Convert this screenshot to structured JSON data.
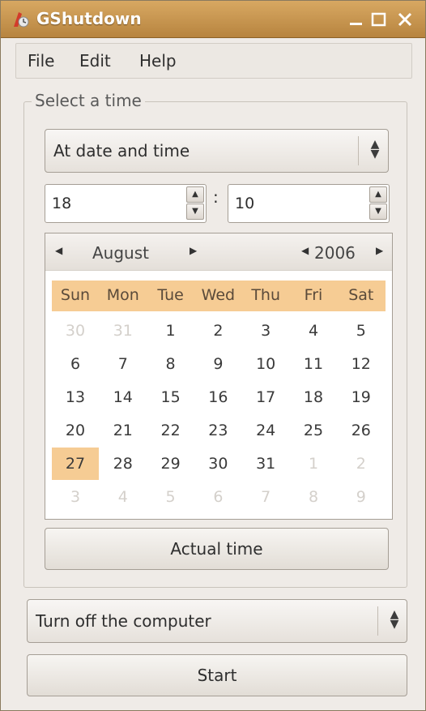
{
  "window": {
    "title": "GShutdown"
  },
  "menu": {
    "file": "File",
    "edit": "Edit",
    "help": "Help"
  },
  "frame": {
    "label": "Select a time"
  },
  "mode_combo": {
    "selected": "At date and time"
  },
  "time": {
    "hour": "18",
    "minute": "10",
    "separator": ":"
  },
  "calendar": {
    "month": "August",
    "year": "2006",
    "weekdays": [
      "Sun",
      "Mon",
      "Tue",
      "Wed",
      "Thu",
      "Fri",
      "Sat"
    ],
    "weeks": [
      [
        "30",
        "31",
        "1",
        "2",
        "3",
        "4",
        "5"
      ],
      [
        "6",
        "7",
        "8",
        "9",
        "10",
        "11",
        "12"
      ],
      [
        "13",
        "14",
        "15",
        "16",
        "17",
        "18",
        "19"
      ],
      [
        "20",
        "21",
        "22",
        "23",
        "24",
        "25",
        "26"
      ],
      [
        "27",
        "28",
        "29",
        "30",
        "31",
        "1",
        "2"
      ],
      [
        "3",
        "4",
        "5",
        "6",
        "7",
        "8",
        "9"
      ]
    ],
    "selected_day": "27"
  },
  "actual_time_button": {
    "label": "Actual time"
  },
  "action_combo": {
    "selected": "Turn off the computer"
  },
  "start_button": {
    "label": "Start"
  },
  "colors": {
    "titlebar": "#c8944f",
    "highlight": "#f6cc94",
    "background": "#efebe7"
  },
  "icons": {
    "app": "gshutdown-icon",
    "minimize": "minimize-icon",
    "maximize": "maximize-icon",
    "close": "close-icon"
  }
}
